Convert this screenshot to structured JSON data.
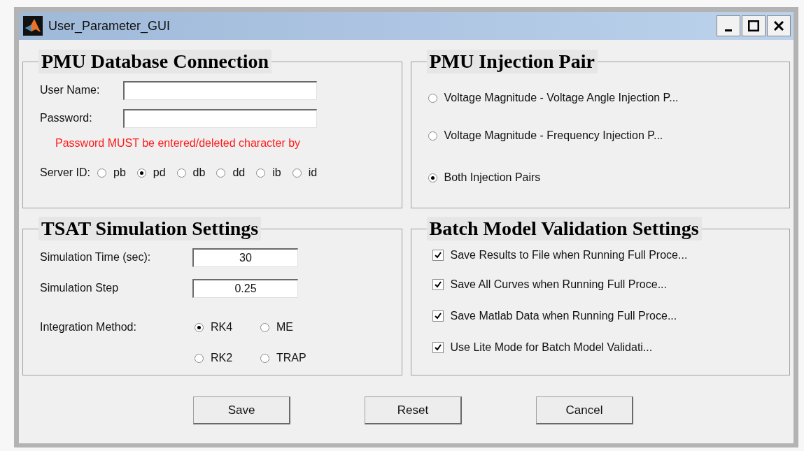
{
  "window": {
    "title": "User_Parameter_GUI"
  },
  "database": {
    "title": "PMU Database Connection",
    "fields": [
      {
        "label": "User Name:"
      },
      {
        "label": "Password:"
      }
    ],
    "warning": "Password MUST be entered/deleted character by",
    "server_label": "Server ID:",
    "servers": [
      {
        "label": "pb",
        "selected": false
      },
      {
        "label": "pd",
        "selected": true
      },
      {
        "label": "db",
        "selected": false
      },
      {
        "label": "dd",
        "selected": false
      },
      {
        "label": "ib",
        "selected": false
      },
      {
        "label": "id",
        "selected": false
      }
    ]
  },
  "injection": {
    "title": "PMU Injection Pair",
    "options": [
      {
        "label": "Voltage Magnitude - Voltage Angle Injection P...",
        "selected": false
      },
      {
        "label": "Voltage Magnitude - Frequency Injection P...",
        "selected": false
      },
      {
        "label": "Both Injection Pairs",
        "selected": true
      }
    ]
  },
  "simulation": {
    "title": "TSAT Simulation Settings",
    "fields": [
      {
        "label": "Simulation Time (sec):",
        "value": "30"
      },
      {
        "label": "Simulation Step",
        "value": "0.25"
      }
    ],
    "method_label": "Integration Method:",
    "methods": [
      {
        "label": "RK4",
        "selected": true
      },
      {
        "label": "ME",
        "selected": false
      },
      {
        "label": "RK2",
        "selected": false
      },
      {
        "label": "TRAP",
        "selected": false
      }
    ]
  },
  "batch": {
    "title": "Batch Model Validation Settings",
    "options": [
      {
        "label": "Save Results to File when Running Full Proce...",
        "checked": true
      },
      {
        "label": "Save All Curves when Running Full Proce...",
        "checked": true
      },
      {
        "label": "Save Matlab Data when Running Full Proce...",
        "checked": true
      },
      {
        "label": "Use Lite Mode for Batch Model Validati...",
        "checked": true
      }
    ]
  },
  "buttons": [
    "Save",
    "Reset",
    "Cancel"
  ]
}
